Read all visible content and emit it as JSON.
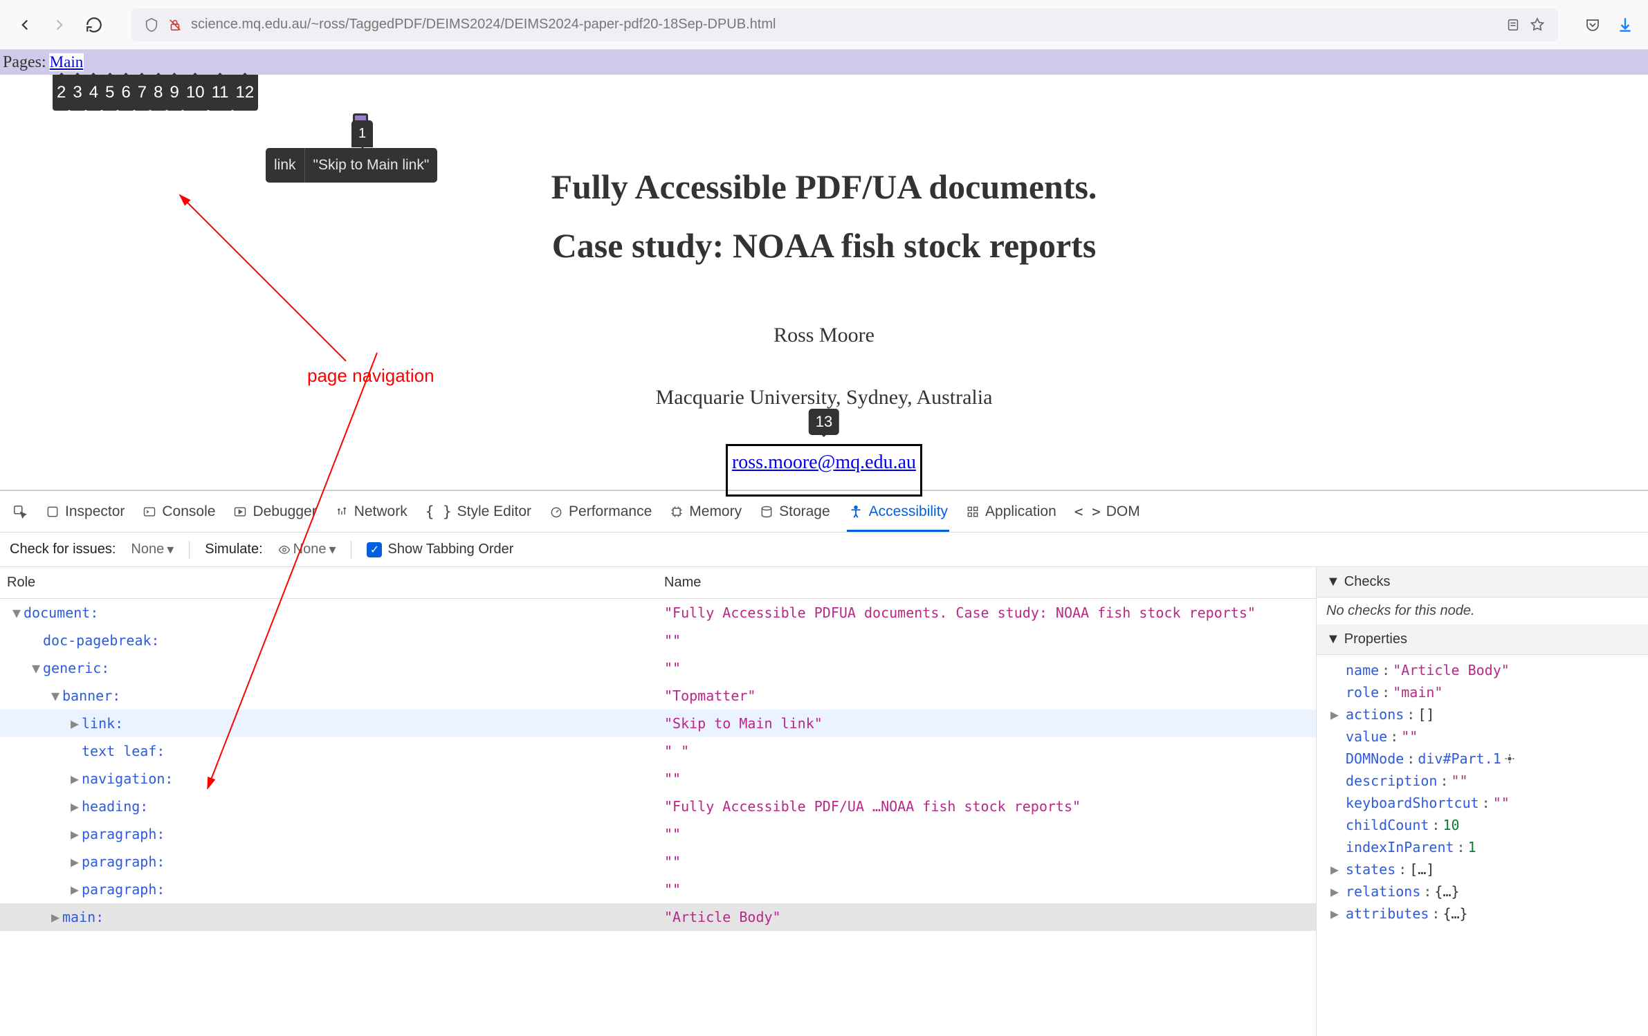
{
  "browser": {
    "url": "science.mq.edu.au/~ross/TaggedPDF/DEIMS2024/DEIMS2024-paper-pdf20-18Sep-DPUB.html"
  },
  "page": {
    "pages_label": "Pages: ",
    "first_link": "Main",
    "tab_order": [
      "2",
      "3",
      "4",
      "5",
      "6",
      "7",
      "8",
      "9",
      "10",
      "11",
      "12"
    ],
    "link_tooltip_role": "link",
    "link_tooltip_text": "\"Skip to Main link\"",
    "link_tooltip_num": "1",
    "title_line1": "Fully Accessible PDF/UA documents.",
    "title_line2": "Case study: NOAA fish stock reports",
    "author": "Ross Moore",
    "affiliation": "Macquarie University, Sydney, Australia",
    "email": "ross.moore@mq.edu.au",
    "email_badge": "13",
    "annotation_label": "page navigation"
  },
  "devtools": {
    "tabs": {
      "inspector": "Inspector",
      "console": "Console",
      "debugger": "Debugger",
      "network": "Network",
      "style": "Style Editor",
      "performance": "Performance",
      "memory": "Memory",
      "storage": "Storage",
      "accessibility": "Accessibility",
      "application": "Application",
      "dom": "DOM"
    },
    "subbar": {
      "check_label": "Check for issues:",
      "check_value": "None",
      "simulate_label": "Simulate:",
      "simulate_value": "None",
      "tabbing_label": "Show Tabbing Order"
    },
    "tree_headers": {
      "role": "Role",
      "name": "Name"
    },
    "tree": [
      {
        "indent": 0,
        "twisty": "▼",
        "role": "document:",
        "name": "\"Fully Accessible PDFUA documents. Case study: NOAA fish stock reports\"",
        "sel": false
      },
      {
        "indent": 1,
        "twisty": "",
        "role": "doc-pagebreak:",
        "name": "\"\""
      },
      {
        "indent": 1,
        "twisty": "▼",
        "role": "generic:",
        "name": "\"\""
      },
      {
        "indent": 2,
        "twisty": "▼",
        "role": "banner:",
        "name": "\"Topmatter\""
      },
      {
        "indent": 3,
        "twisty": "▶",
        "role": "link:",
        "name": "\"Skip to Main link\"",
        "sel": true
      },
      {
        "indent": 3,
        "twisty": "",
        "role": "text leaf:",
        "name": "\" \""
      },
      {
        "indent": 3,
        "twisty": "▶",
        "role": "navigation:",
        "name": "\"\""
      },
      {
        "indent": 3,
        "twisty": "▶",
        "role": "heading:",
        "name": "\"Fully Accessible PDF/UA …NOAA fish stock reports\""
      },
      {
        "indent": 3,
        "twisty": "▶",
        "role": "paragraph:",
        "name": "\"\""
      },
      {
        "indent": 3,
        "twisty": "▶",
        "role": "paragraph:",
        "name": "\"\""
      },
      {
        "indent": 3,
        "twisty": "▶",
        "role": "paragraph:",
        "name": "\"\""
      },
      {
        "indent": 2,
        "twisty": "▶",
        "role": "main:",
        "name": "\"Article Body\"",
        "hl": true
      }
    ],
    "checks": {
      "header": "Checks",
      "body": "No checks for this node."
    },
    "properties": {
      "header": "Properties",
      "rows": [
        {
          "k": "name",
          "v": "\"Article Body\"",
          "t": "str"
        },
        {
          "k": "role",
          "v": "\"main\"",
          "t": "str"
        },
        {
          "k": "actions",
          "v": "[]",
          "t": "obj",
          "tw": "▶"
        },
        {
          "k": "value",
          "v": "\"\"",
          "t": "str"
        },
        {
          "k": "DOMNode",
          "v": "div#Part.1",
          "t": "dom"
        },
        {
          "k": "description",
          "v": "\"\"",
          "t": "str"
        },
        {
          "k": "keyboardShortcut",
          "v": "\"\"",
          "t": "str"
        },
        {
          "k": "childCount",
          "v": "10",
          "t": "num"
        },
        {
          "k": "indexInParent",
          "v": "1",
          "t": "num"
        },
        {
          "k": "states",
          "v": "[…]",
          "t": "obj",
          "tw": "▶"
        },
        {
          "k": "relations",
          "v": "{…}",
          "t": "obj",
          "tw": "▶"
        },
        {
          "k": "attributes",
          "v": "{…}",
          "t": "obj",
          "tw": "▶"
        }
      ]
    }
  }
}
